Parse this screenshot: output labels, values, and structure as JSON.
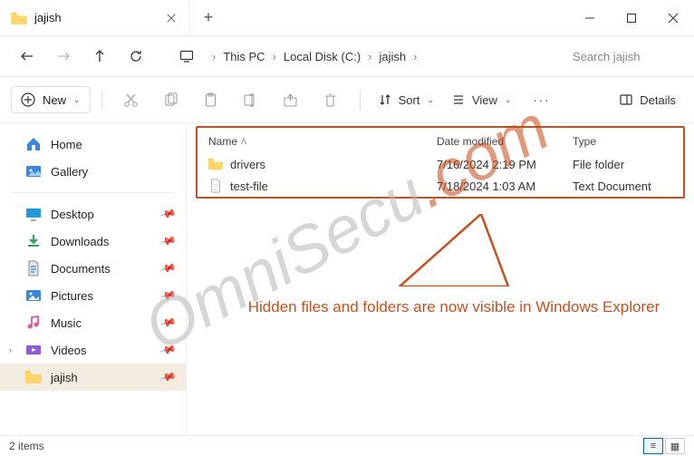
{
  "titlebar": {
    "tab_title": "jajish"
  },
  "breadcrumb": {
    "items": [
      "This PC",
      "Local Disk (C:)",
      "jajish"
    ]
  },
  "search": {
    "placeholder": "Search jajish"
  },
  "toolbar": {
    "new_label": "New",
    "sort_label": "Sort",
    "view_label": "View",
    "details_label": "Details"
  },
  "sidebar": {
    "items": [
      {
        "label": "Home"
      },
      {
        "label": "Gallery"
      },
      {
        "label": "Desktop"
      },
      {
        "label": "Downloads"
      },
      {
        "label": "Documents"
      },
      {
        "label": "Pictures"
      },
      {
        "label": "Music"
      },
      {
        "label": "Videos"
      },
      {
        "label": "jajish"
      }
    ]
  },
  "content": {
    "columns": {
      "name": "Name",
      "date": "Date modified",
      "type": "Type"
    },
    "rows": [
      {
        "name": "drivers",
        "date": "7/16/2024 2:19 PM",
        "type": "File folder",
        "kind": "folder"
      },
      {
        "name": "test-file",
        "date": "7/18/2024 1:03 AM",
        "type": "Text Document",
        "kind": "file"
      }
    ]
  },
  "callout": {
    "text": "Hidden files and folders are now visible in Windows Explorer"
  },
  "statusbar": {
    "count": "2 items"
  },
  "watermark": {
    "part1": "OmniSecu",
    "part2": ".com"
  }
}
